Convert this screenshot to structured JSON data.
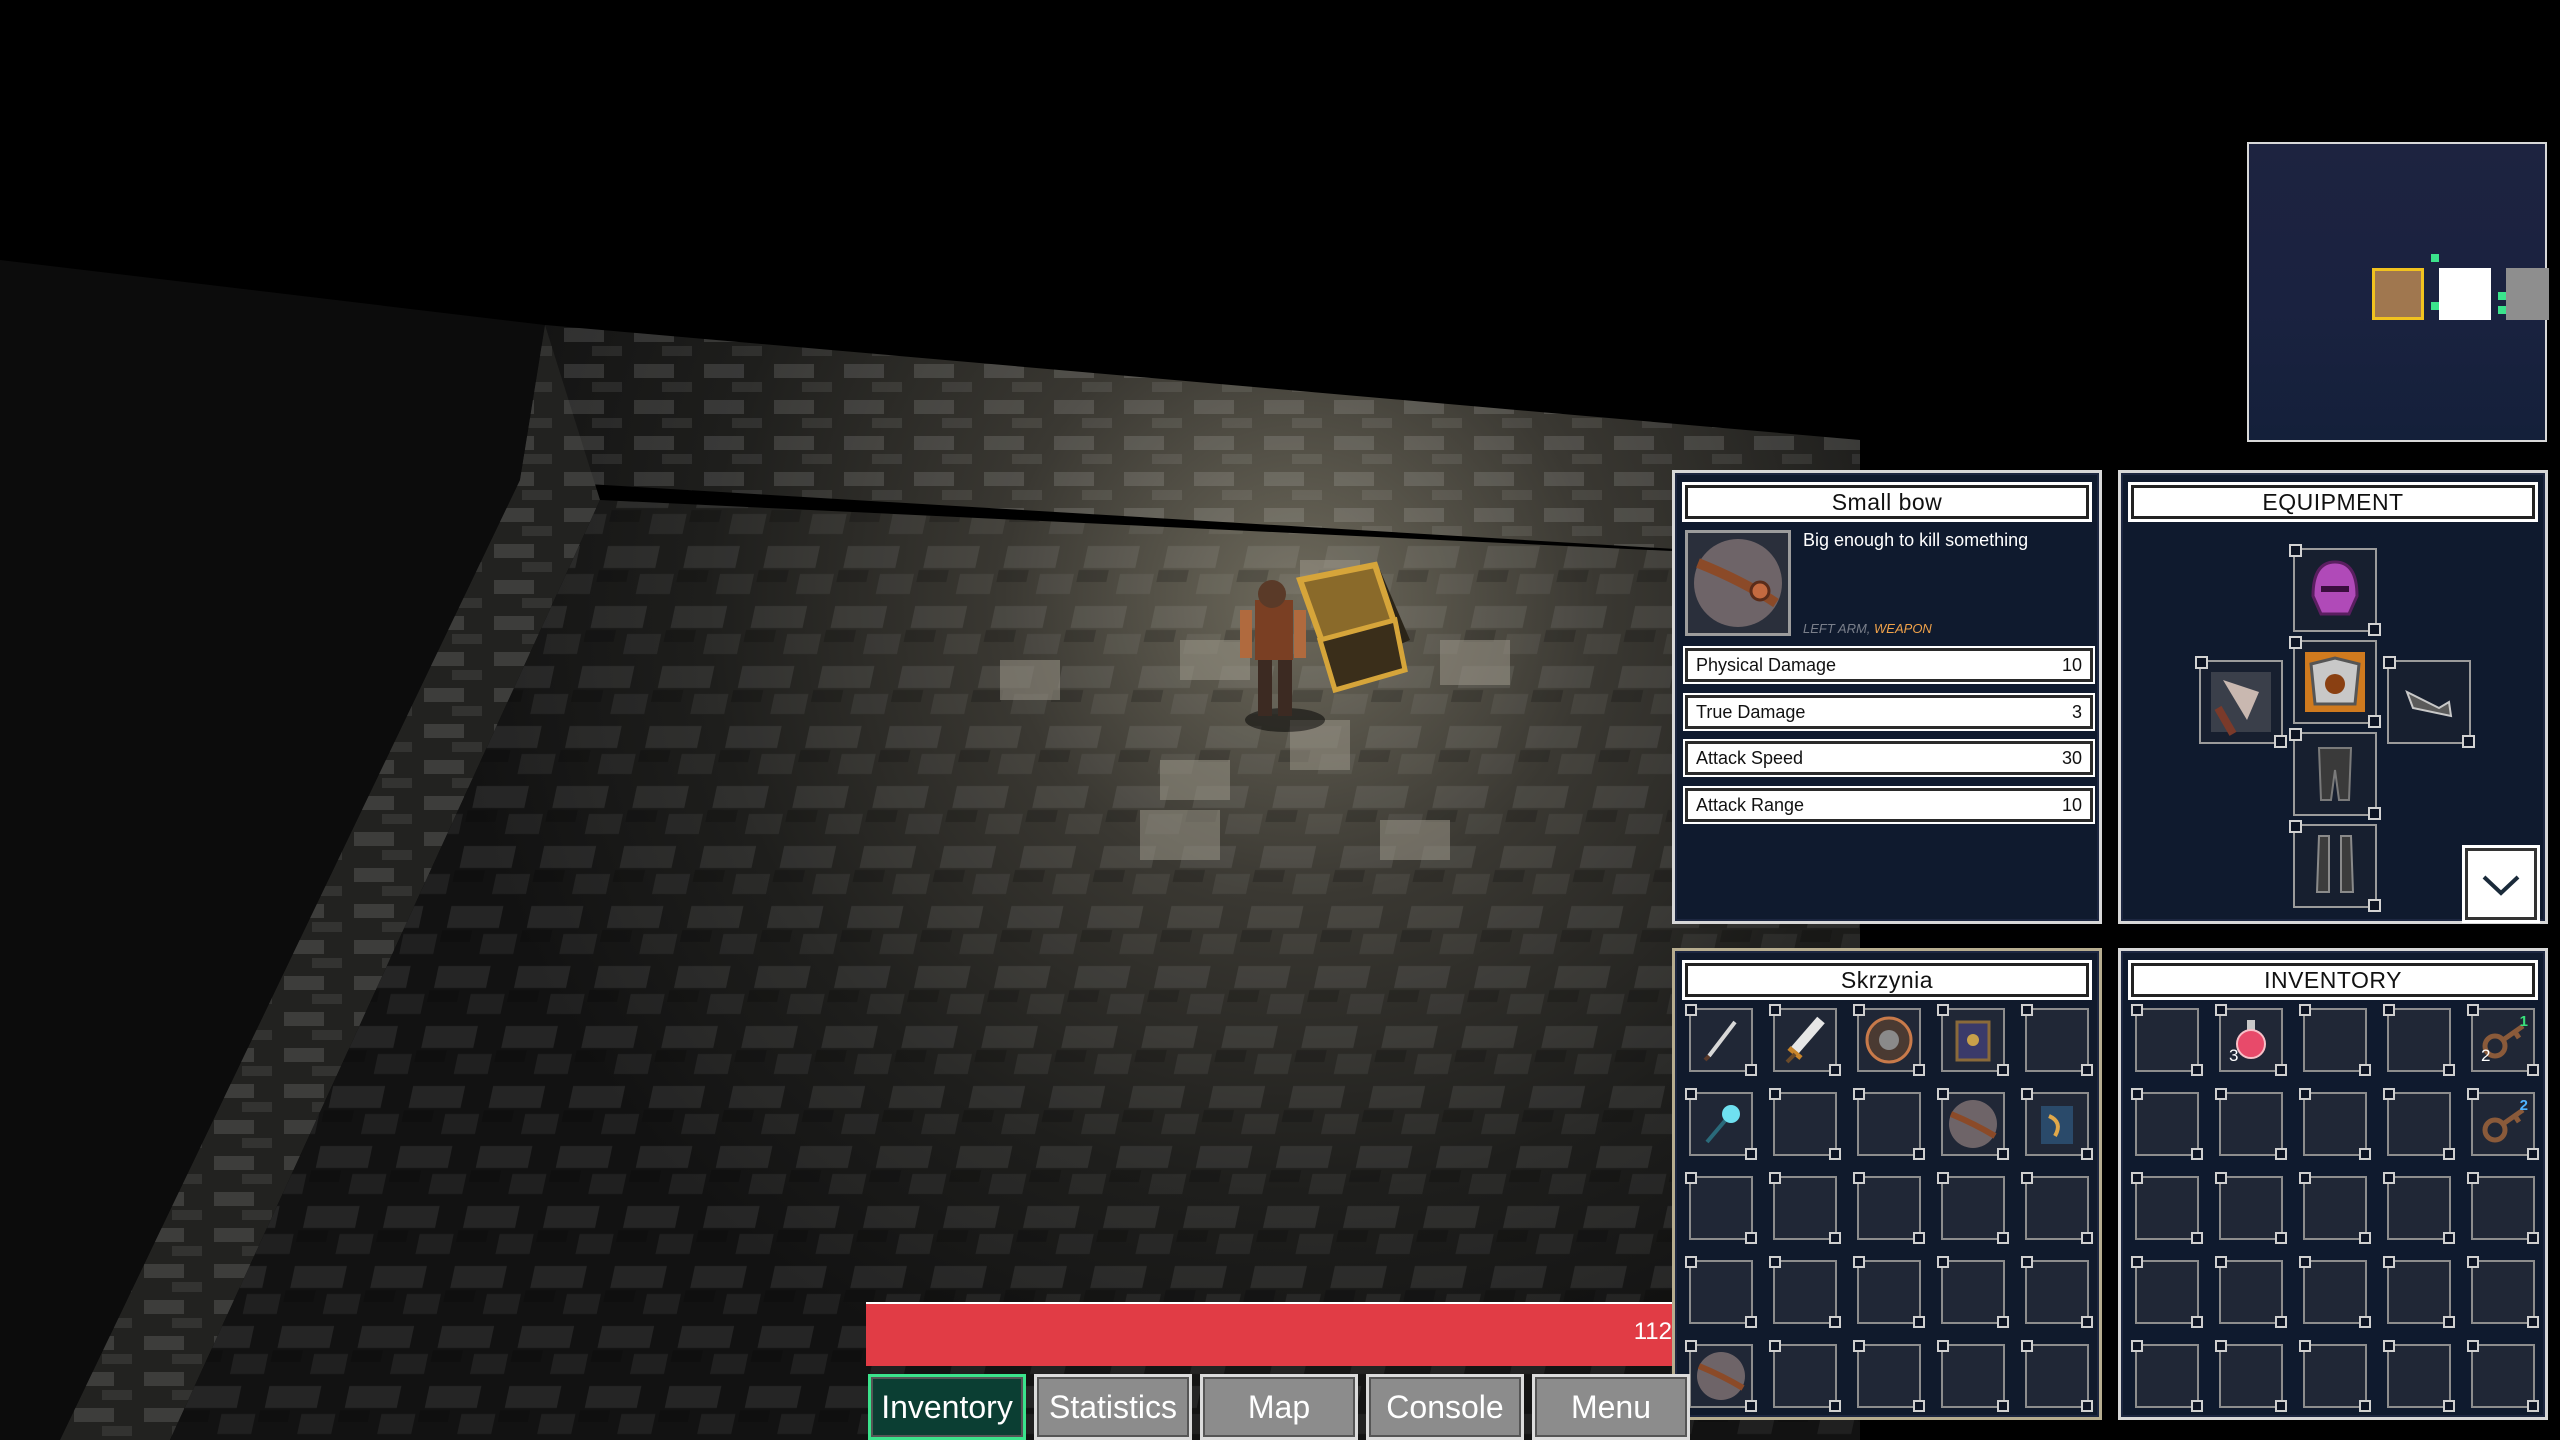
{
  "game": {
    "hp_value": "112",
    "colors": {
      "hp_bar": "#e13c45",
      "panel_bg": "#0f1a2e",
      "active_button": "#3be38c"
    }
  },
  "item_tooltip": {
    "title": "Small bow",
    "description": "Big enough to kill something",
    "slot_label": "LEFT ARM, ",
    "type_label": "WEAPON",
    "icon": "bow-icon",
    "stats": [
      {
        "name": "Physical Damage",
        "value": "10"
      },
      {
        "name": "True Damage",
        "value": "3"
      },
      {
        "name": "Attack Speed",
        "value": "30"
      },
      {
        "name": "Attack Range",
        "value": "10"
      }
    ]
  },
  "equipment": {
    "title": "EQUIPMENT",
    "slots": {
      "head": "helmet-icon",
      "chest": "chest-armor-icon",
      "left_arm": "axe-icon",
      "right_arm": "gauntlet-icon",
      "legs": "leg-armor-icon",
      "feet": "boots-icon"
    },
    "toggle_icon": "chevron-down-icon"
  },
  "chest": {
    "title": "Skrzynia",
    "rows": [
      [
        "sword-icon",
        "greatsword-icon",
        "shield-icon",
        "spellbook-icon",
        ""
      ],
      [
        "staff-icon",
        "",
        "",
        "bow-icon",
        "scroll-icon"
      ],
      [
        "",
        "",
        "",
        "",
        ""
      ],
      [
        "",
        "",
        "",
        "",
        ""
      ],
      [
        "bow-icon",
        "",
        "",
        "",
        ""
      ]
    ]
  },
  "inventory": {
    "title": "INVENTORY",
    "items": [
      {
        "row": 0,
        "col": 1,
        "icon": "potion-icon",
        "qty": "3"
      },
      {
        "row": 0,
        "col": 4,
        "icon": "key-icon",
        "qty": "2",
        "badge": "1"
      },
      {
        "row": 1,
        "col": 4,
        "icon": "key-icon",
        "badge": "2"
      }
    ]
  },
  "nav": {
    "buttons": [
      "Inventory",
      "Statistics",
      "Map",
      "Console",
      "Menu"
    ]
  }
}
